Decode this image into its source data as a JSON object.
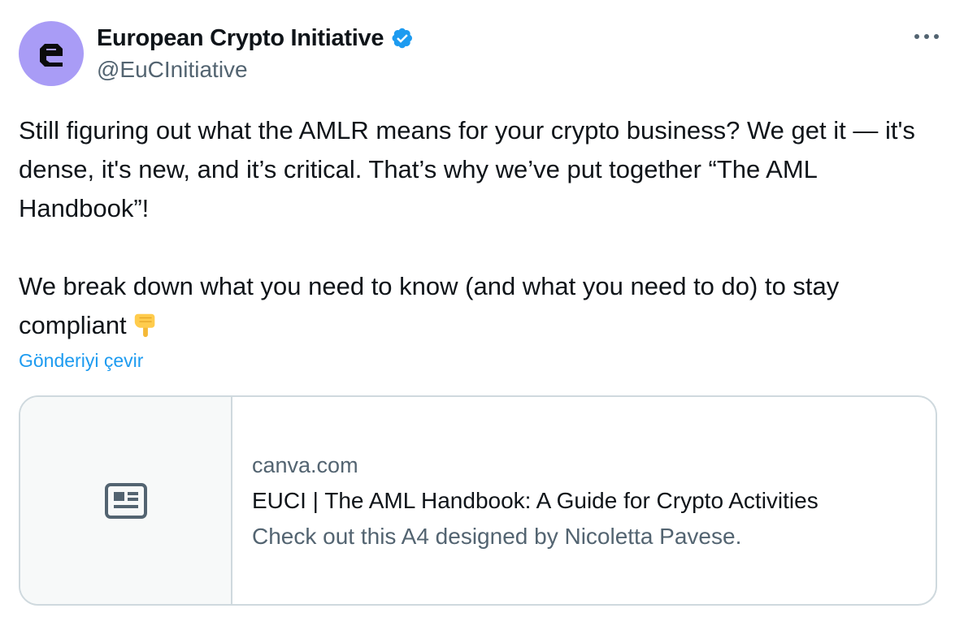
{
  "author": {
    "display_name": "European Crypto Initiative",
    "handle": "@EuCInitiative",
    "verified": true,
    "avatar_color": "#a99cf6"
  },
  "tweet": {
    "paragraph1": "Still figuring out what the AMLR means for your crypto business? We get it — it's dense, it's new, and it’s critical. That’s why we’ve put together “The AML Handbook”!",
    "paragraph2": "We break down what you need to know (and what you need to do) to stay compliant",
    "emoji": "backhand-index-pointing-down",
    "translate_label": "Gönderiyi çevir"
  },
  "link_card": {
    "domain": "canva.com",
    "title": "EUCI | The AML Handbook: A Guide for Crypto Activities",
    "description": "Check out this A4 designed by Nicoletta Pavese.",
    "media_icon": "article-icon"
  },
  "colors": {
    "link": "#1d9bf0",
    "secondary_text": "#536471",
    "verified_badge": "#1d9bf0",
    "border": "#cfd9de"
  }
}
